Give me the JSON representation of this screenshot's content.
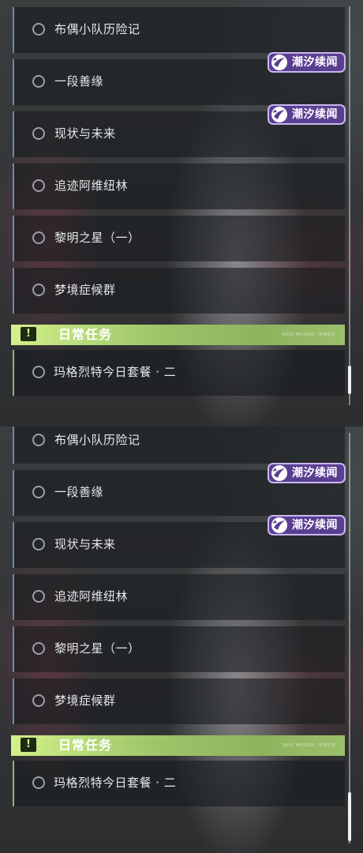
{
  "panels": [
    {
      "quests": [
        {
          "label": "布偶小队历险记"
        },
        {
          "label": "一段善缘"
        },
        {
          "label": "现状与未来"
        },
        {
          "label": "追迹阿维纽林"
        },
        {
          "label": "黎明之星（一）"
        },
        {
          "label": "梦境症候群"
        }
      ],
      "tags": [
        {
          "label": "潮汐续闻"
        },
        {
          "label": "潮汐续闻"
        }
      ],
      "daily_header": {
        "title": "日常任务",
        "icon": "!",
        "small_text": "DAILY MISSION · 日常任务"
      },
      "daily_quests": [
        {
          "label": "玛格烈特今日套餐 · 二"
        }
      ]
    },
    {
      "quests": [
        {
          "label": "布偶小队历险记"
        },
        {
          "label": "一段善缘"
        },
        {
          "label": "现状与未来"
        },
        {
          "label": "追迹阿维纽林"
        },
        {
          "label": "黎明之星（一）"
        },
        {
          "label": "梦境症候群"
        }
      ],
      "tags": [
        {
          "label": "潮汐续闻"
        },
        {
          "label": "潮汐续闻"
        }
      ],
      "daily_header": {
        "title": "日常任务",
        "icon": "!",
        "small_text": "DAILY MISSION · 日常任务"
      },
      "daily_quests": [
        {
          "label": "玛格烈特今日套餐 · 二"
        }
      ]
    }
  ],
  "colors": {
    "quest_accent": "#6d8aa3",
    "daily_accent": "#8fb57a",
    "tag_bg": "#5a3f91",
    "header_green": "#b8dd7a"
  }
}
